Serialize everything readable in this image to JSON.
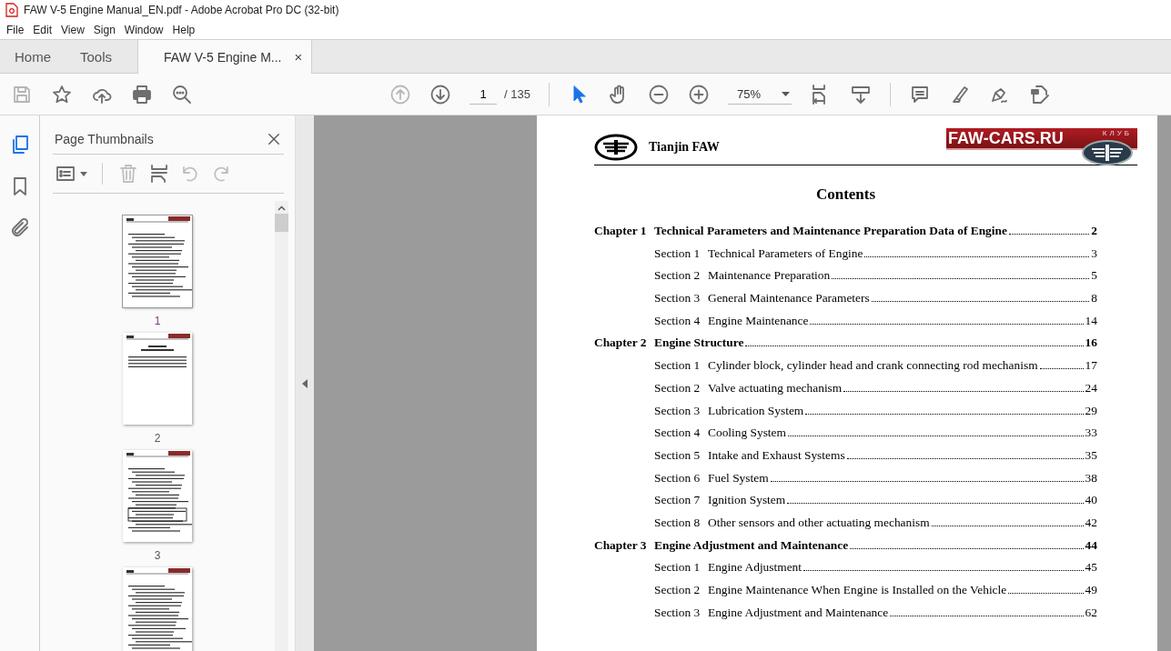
{
  "window": {
    "title": "FAW V-5 Engine Manual_EN.pdf - Adobe Acrobat Pro DC (32-bit)"
  },
  "menu": [
    "File",
    "Edit",
    "View",
    "Sign",
    "Window",
    "Help"
  ],
  "tabs": [
    {
      "label": "Home",
      "selected": false
    },
    {
      "label": "Tools",
      "selected": false
    },
    {
      "label": "FAW V-5 Engine M...",
      "selected": true,
      "close": "×"
    }
  ],
  "toolbar": {
    "page": "1",
    "page_total": "/ 135",
    "zoom": "75%"
  },
  "panel": {
    "title": "Page Thumbnails",
    "thumbnails": [
      {
        "label": "1",
        "selected": true
      },
      {
        "label": "2",
        "selected": false
      },
      {
        "label": "3",
        "selected": false
      },
      {
        "selected": false
      }
    ]
  },
  "document": {
    "company": "Tianjin FAW",
    "logo_text": "FAW-CARS.RU",
    "logo_subtext": "КЛУБ",
    "heading": "Contents",
    "entries": [
      {
        "kind": "chapter",
        "label": "Chapter 1",
        "title": "Technical Parameters and Maintenance Preparation Data of Engine",
        "page": "2"
      },
      {
        "kind": "section",
        "label": "Section 1",
        "title": "Technical Parameters of Engine",
        "page": "3"
      },
      {
        "kind": "section",
        "label": "Section 2",
        "title": "Maintenance Preparation",
        "page": "5"
      },
      {
        "kind": "section",
        "label": "Section 3",
        "title": "General Maintenance Parameters",
        "page": "8"
      },
      {
        "kind": "section",
        "label": "Section 4",
        "title": "Engine Maintenance",
        "page": "14"
      },
      {
        "kind": "chapter",
        "label": "Chapter 2",
        "title": "Engine Structure",
        "page": "16"
      },
      {
        "kind": "section",
        "label": "Section 1",
        "title": "Cylinder block, cylinder head and crank connecting rod mechanism",
        "page": "17"
      },
      {
        "kind": "section",
        "label": "Section 2",
        "title": "Valve actuating mechanism",
        "page": "24"
      },
      {
        "kind": "section",
        "label": "Section 3",
        "title": "Lubrication System",
        "page": "29"
      },
      {
        "kind": "section",
        "label": "Section 4",
        "title": "Cooling System",
        "page": "33"
      },
      {
        "kind": "section",
        "label": "Section 5",
        "title": "Intake and Exhaust Systems",
        "page": "35"
      },
      {
        "kind": "section",
        "label": "Section 6",
        "title": "Fuel System",
        "page": "38"
      },
      {
        "kind": "section",
        "label": "Section 7",
        "title": "Ignition System",
        "page": "40"
      },
      {
        "kind": "section",
        "label": "Section 8",
        "title": "Other sensors and other actuating mechanism",
        "page": "42"
      },
      {
        "kind": "chapter",
        "label": "Chapter 3",
        "title": "Engine Adjustment and Maintenance",
        "page": "44"
      },
      {
        "kind": "section",
        "label": "Section 1",
        "title": "Engine Adjustment",
        "page": "45"
      },
      {
        "kind": "section",
        "label": "Section 2",
        "title": "Engine Maintenance When Engine is Installed on the Vehicle",
        "page": "49"
      },
      {
        "kind": "section",
        "label": "Section 3",
        "title": "Engine Adjustment and Maintenance",
        "page": "62"
      }
    ]
  }
}
